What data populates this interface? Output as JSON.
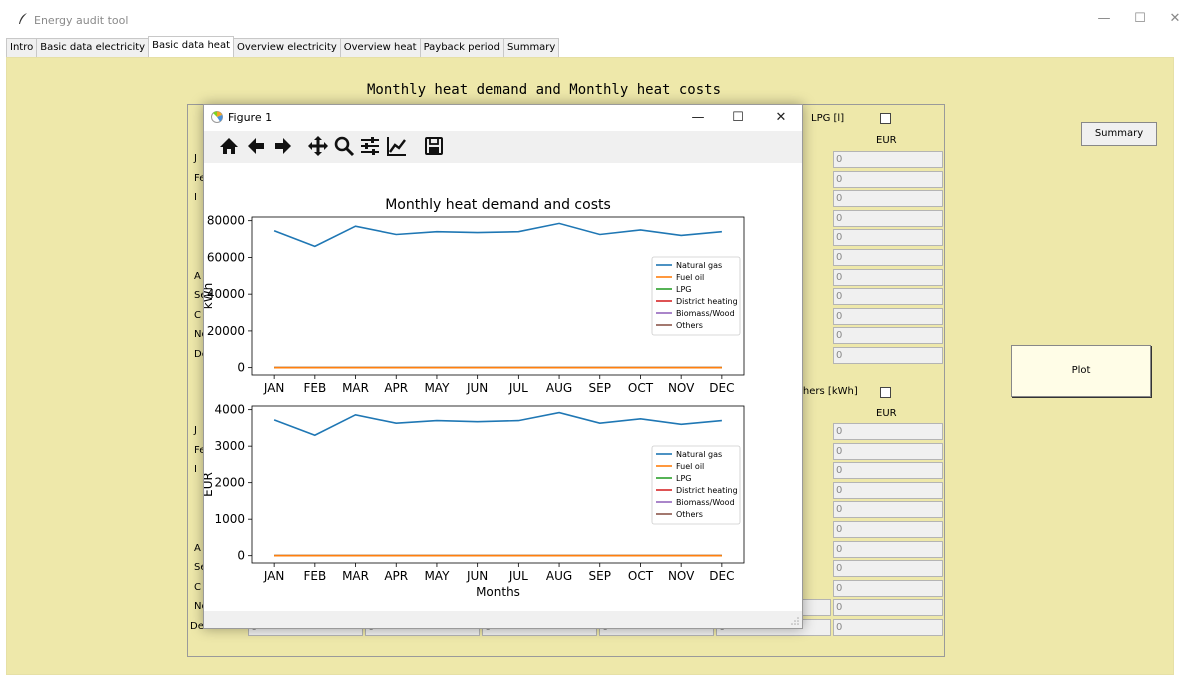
{
  "window": {
    "title": "Energy audit tool",
    "controls": [
      "—",
      "☐",
      "✕"
    ]
  },
  "tabs": [
    "Intro",
    "Basic data electricity",
    "Basic data heat",
    "Overview electricity",
    "Overview heat",
    "Payback period",
    "Summary"
  ],
  "active_tab": "Basic data heat",
  "heading": "Monthly heat demand and Monthly heat costs",
  "table": {
    "top_header": "LPG [l]",
    "top_sub": "EUR",
    "bottom_header": "thers [kWh]",
    "bottom_sub": "EUR",
    "left_labels_top": [
      "J",
      "Fe",
      "I",
      "",
      "",
      "",
      "A",
      "Se",
      "C",
      "No",
      "De"
    ],
    "left_labels_bottom": [
      "J",
      "Fe",
      "I",
      "",
      "",
      "",
      "A",
      "Se",
      "C",
      "No",
      "December"
    ],
    "december_label": "December",
    "november_partial": "November",
    "cell_value": "0"
  },
  "buttons": {
    "summary": "Summary",
    "plot": "Plot"
  },
  "figure": {
    "title": "Figure 1",
    "controls": [
      "—",
      "☐",
      "✕"
    ],
    "tools": [
      "home-icon",
      "back-icon",
      "forward-icon",
      "pan-icon",
      "zoom-icon",
      "configure-icon",
      "edit-axis-icon",
      "save-icon"
    ]
  },
  "chart_data": [
    {
      "type": "line",
      "title": "Monthly heat demand and costs",
      "xlabel": "",
      "ylabel": "kWh",
      "categories": [
        "JAN",
        "FEB",
        "MAR",
        "APR",
        "MAY",
        "JUN",
        "JUL",
        "AUG",
        "SEP",
        "OCT",
        "NOV",
        "DEC"
      ],
      "ylim": [
        -4000,
        82000
      ],
      "yticks": [
        "0",
        "20000",
        "40000",
        "60000",
        "80000"
      ],
      "legend_position": "center-right",
      "series": [
        {
          "name": "Natural gas",
          "color": "#1f77b4",
          "values": [
            74500,
            66000,
            77000,
            72500,
            74000,
            73500,
            74000,
            78500,
            72500,
            75000,
            72000,
            74000
          ]
        },
        {
          "name": "Fuel oil",
          "color": "#ff7f0e",
          "values": [
            0,
            0,
            0,
            0,
            0,
            0,
            0,
            0,
            0,
            0,
            0,
            0
          ]
        },
        {
          "name": "LPG",
          "color": "#2ca02c",
          "values": [
            0,
            0,
            0,
            0,
            0,
            0,
            0,
            0,
            0,
            0,
            0,
            0
          ]
        },
        {
          "name": "District heating",
          "color": "#d62728",
          "values": [
            0,
            0,
            0,
            0,
            0,
            0,
            0,
            0,
            0,
            0,
            0,
            0
          ]
        },
        {
          "name": "Biomass/Wood",
          "color": "#9467bd",
          "values": [
            0,
            0,
            0,
            0,
            0,
            0,
            0,
            0,
            0,
            0,
            0,
            0
          ]
        },
        {
          "name": "Others",
          "color": "#8c564b",
          "values": [
            0,
            0,
            0,
            0,
            0,
            0,
            0,
            0,
            0,
            0,
            0,
            0
          ]
        }
      ]
    },
    {
      "type": "line",
      "title": "",
      "xlabel": "Months",
      "ylabel": "EUR",
      "categories": [
        "JAN",
        "FEB",
        "MAR",
        "APR",
        "MAY",
        "JUN",
        "JUL",
        "AUG",
        "SEP",
        "OCT",
        "NOV",
        "DEC"
      ],
      "ylim": [
        -200,
        4100
      ],
      "yticks": [
        "0",
        "1000",
        "2000",
        "3000",
        "4000"
      ],
      "legend_position": "center-right",
      "series": [
        {
          "name": "Natural gas",
          "color": "#1f77b4",
          "values": [
            3720,
            3300,
            3860,
            3630,
            3700,
            3670,
            3700,
            3920,
            3630,
            3750,
            3600,
            3700
          ]
        },
        {
          "name": "Fuel oil",
          "color": "#ff7f0e",
          "values": [
            0,
            0,
            0,
            0,
            0,
            0,
            0,
            0,
            0,
            0,
            0,
            0
          ]
        },
        {
          "name": "LPG",
          "color": "#2ca02c",
          "values": [
            0,
            0,
            0,
            0,
            0,
            0,
            0,
            0,
            0,
            0,
            0,
            0
          ]
        },
        {
          "name": "District heating",
          "color": "#d62728",
          "values": [
            0,
            0,
            0,
            0,
            0,
            0,
            0,
            0,
            0,
            0,
            0,
            0
          ]
        },
        {
          "name": "Biomass/Wood",
          "color": "#9467bd",
          "values": [
            0,
            0,
            0,
            0,
            0,
            0,
            0,
            0,
            0,
            0,
            0,
            0
          ]
        },
        {
          "name": "Others",
          "color": "#8c564b",
          "values": [
            0,
            0,
            0,
            0,
            0,
            0,
            0,
            0,
            0,
            0,
            0,
            0
          ]
        }
      ]
    }
  ]
}
